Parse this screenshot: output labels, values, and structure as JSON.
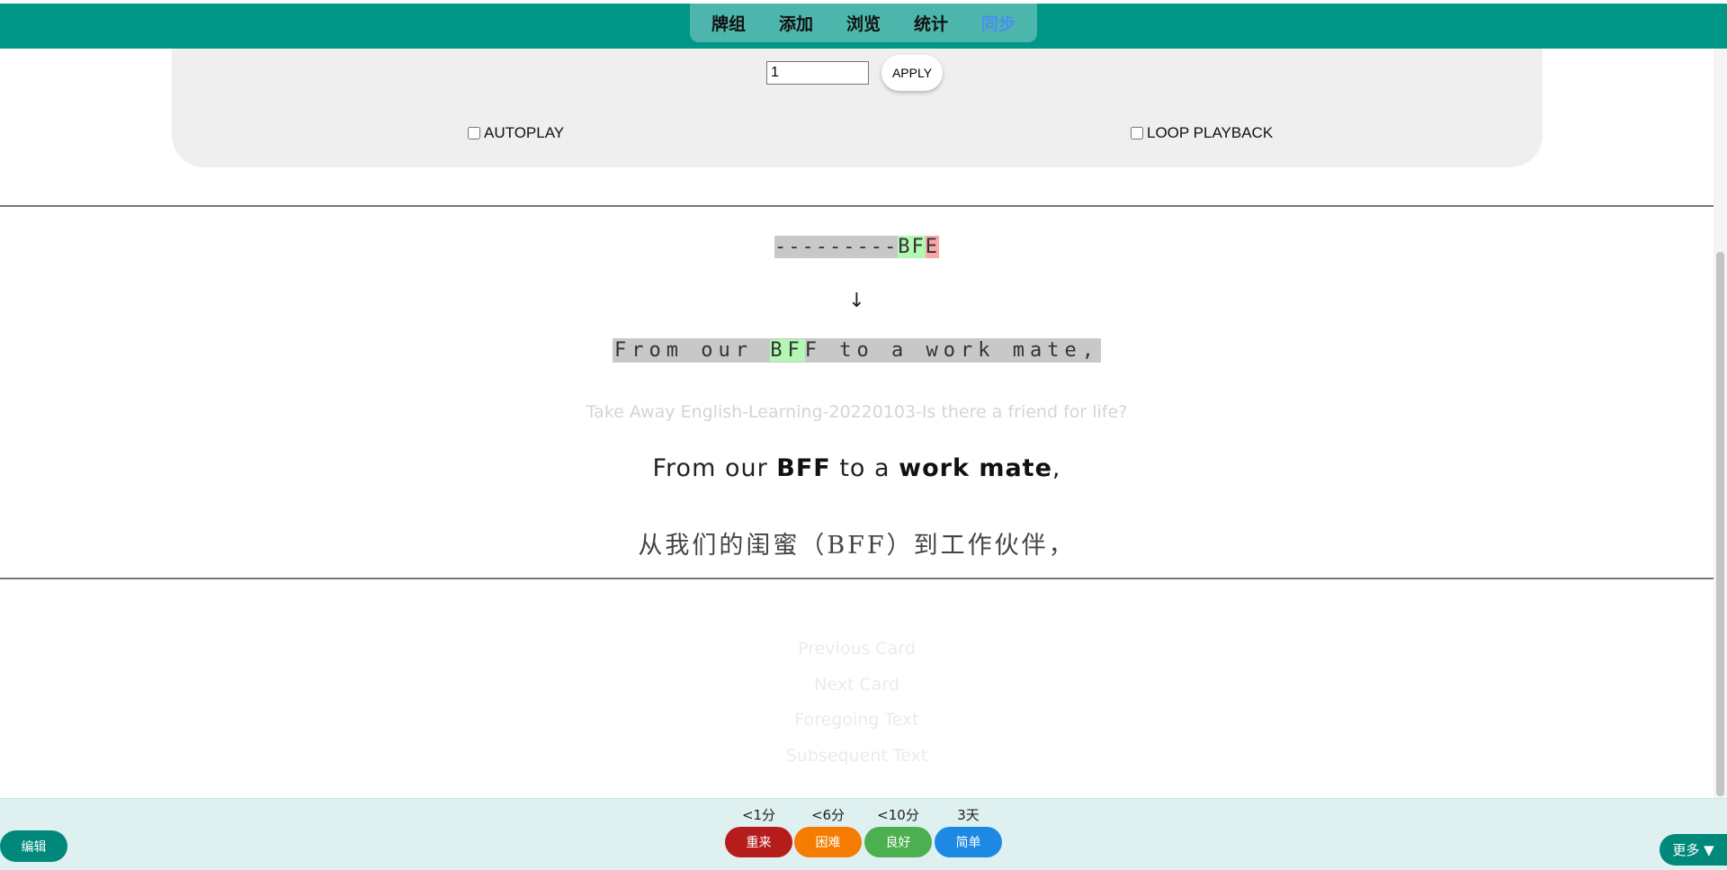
{
  "topnav": {
    "items": [
      "牌组",
      "添加",
      "浏览",
      "统计",
      "同步"
    ],
    "active_index": 4,
    "active_color": "#4a8ff0"
  },
  "panel": {
    "number_value": "1",
    "apply_label": "APPLY",
    "autoplay_label": "AUTOPLAY",
    "loop_label": "LOOP PLAYBACK"
  },
  "card": {
    "cloze": {
      "dashes": "---------",
      "correct": "BF",
      "wrong": "E"
    },
    "arrow": "↓",
    "diff": {
      "before": "From our ",
      "match": "BF",
      "after": "F to a work mate,"
    },
    "source": "Take Away English-Learning-20220103-Is there a friend for life?",
    "sentence": {
      "part1": "From our ",
      "bold1": "BFF",
      "part2": " to a ",
      "bold2": "work mate",
      "part3": ","
    },
    "translation": "从我们的闺蜜（BFF）到工作伙伴，"
  },
  "links": {
    "previous_card": "Previous Card",
    "next_card": "Next Card",
    "foregoing_text": "Foregoing Text",
    "subsequent_text": "Subsequent Text"
  },
  "bottom": {
    "edit_label": "编辑",
    "more_label": "更多 ▼",
    "answers": [
      {
        "time": "<1分",
        "label": "重来",
        "color": "#b71c1c"
      },
      {
        "time": "<6分",
        "label": "困难",
        "color": "#f57c00"
      },
      {
        "time": "<10分",
        "label": "良好",
        "color": "#4caf50"
      },
      {
        "time": "3天",
        "label": "简单",
        "color": "#1e88e5"
      }
    ]
  },
  "colors": {
    "brand_teal": "#009688",
    "nav_pill": "#4db6ac",
    "diff_green": "#b2f7b2",
    "diff_red": "#f7a8a8"
  }
}
